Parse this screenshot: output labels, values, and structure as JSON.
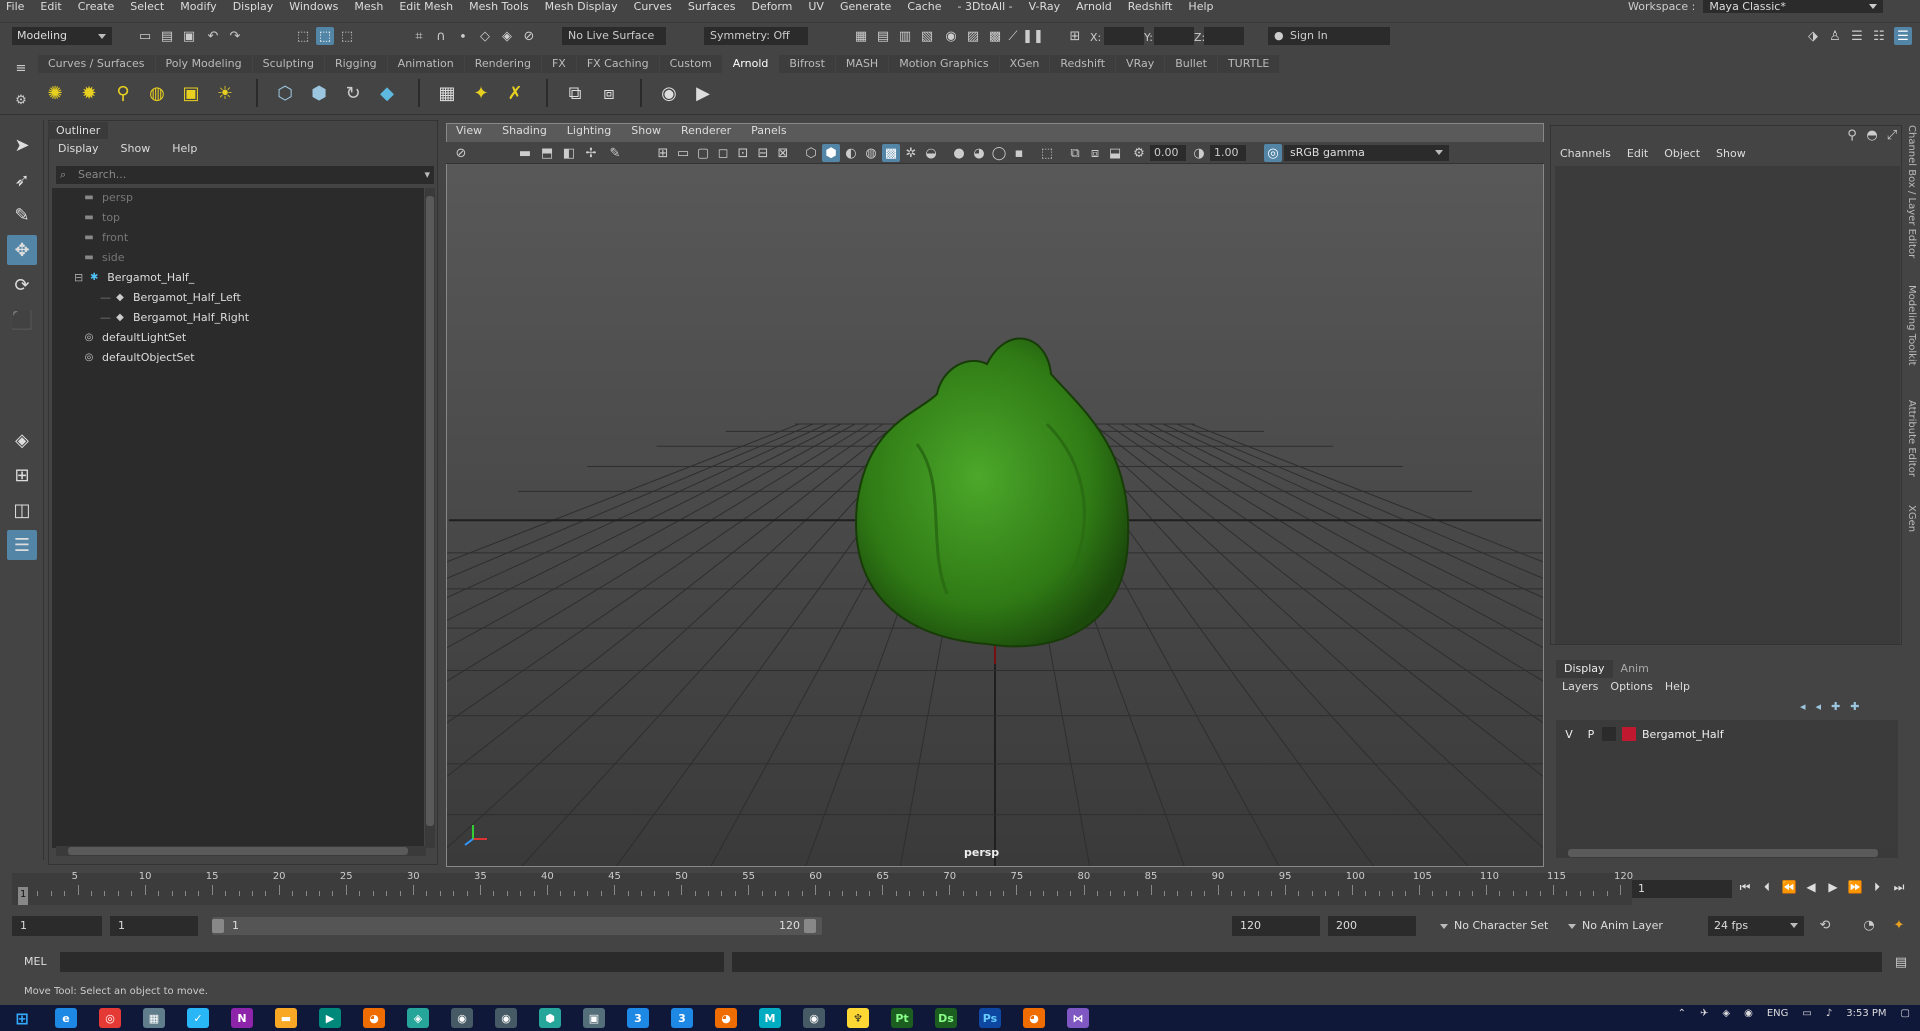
{
  "menubar": {
    "items": [
      "File",
      "Edit",
      "Create",
      "Select",
      "Modify",
      "Display",
      "Windows",
      "Mesh",
      "Edit Mesh",
      "Mesh Tools",
      "Mesh Display",
      "Curves",
      "Surfaces",
      "Deform",
      "UV",
      "Generate",
      "Cache",
      "- 3DtoAll -",
      "V-Ray",
      "Arnold",
      "Redshift",
      "Help"
    ],
    "workspace_label": "Workspace :",
    "workspace_value": "Maya Classic*"
  },
  "statusline": {
    "mode": "Modeling",
    "live_surface": "No Live Surface",
    "symmetry": "Symmetry: Off",
    "x_label": "X:",
    "y_label": "Y:",
    "z_label": "Z:",
    "sign_in": "Sign In"
  },
  "shelf": {
    "tabs": [
      "Curves / Surfaces",
      "Poly Modeling",
      "Sculpting",
      "Rigging",
      "Animation",
      "Rendering",
      "FX",
      "FX Caching",
      "Custom",
      "Arnold",
      "Bifrost",
      "MASH",
      "Motion Graphics",
      "XGen",
      "Redshift",
      "VRay",
      "Bullet",
      "TURTLE"
    ],
    "active_tab": "Arnold"
  },
  "outliner": {
    "title": "Outliner",
    "menu": [
      "Display",
      "Show",
      "Help"
    ],
    "search_placeholder": "Search...",
    "items": [
      {
        "label": "persp",
        "icon": "camera-icon",
        "dim": true,
        "indent": 1
      },
      {
        "label": "top",
        "icon": "camera-icon",
        "dim": true,
        "indent": 1
      },
      {
        "label": "front",
        "icon": "camera-icon",
        "dim": true,
        "indent": 1
      },
      {
        "label": "side",
        "icon": "camera-icon",
        "dim": true,
        "indent": 1
      },
      {
        "label": "Bergamot_Half_",
        "icon": "group-icon",
        "dim": false,
        "indent": 0
      },
      {
        "label": "Bergamot_Half_Left",
        "icon": "mesh-icon",
        "dim": false,
        "indent": 2
      },
      {
        "label": "Bergamot_Half_Right",
        "icon": "mesh-icon",
        "dim": false,
        "indent": 2
      },
      {
        "label": "defaultLightSet",
        "icon": "set-icon",
        "dim": false,
        "indent": 1
      },
      {
        "label": "defaultObjectSet",
        "icon": "set-icon",
        "dim": false,
        "indent": 1
      }
    ]
  },
  "viewport": {
    "menu": [
      "View",
      "Shading",
      "Lighting",
      "Show",
      "Renderer",
      "Panels"
    ],
    "exposure": "0.00",
    "gamma": "1.00",
    "color_space": "sRGB gamma",
    "camera_label": "persp",
    "object_color": "#3a8a1a"
  },
  "channelbox": {
    "menu": [
      "Channels",
      "Edit",
      "Object",
      "Show"
    ]
  },
  "layereditor": {
    "tabs": [
      "Display",
      "Anim"
    ],
    "active_tab": "Display",
    "menu": [
      "Layers",
      "Options",
      "Help"
    ],
    "layers": [
      {
        "v": "V",
        "p": "P",
        "name": "Bergamot_Half",
        "color": "#c0182f"
      }
    ]
  },
  "sidetabs": [
    "Channel Box / Layer Editor",
    "Modeling Toolkit",
    "Attribute Editor",
    "XGen"
  ],
  "timeslider": {
    "labels": [
      "5",
      "10",
      "15",
      "20",
      "25",
      "30",
      "35",
      "40",
      "45",
      "50",
      "55",
      "60",
      "65",
      "70",
      "75",
      "80",
      "85",
      "90",
      "95",
      "100",
      "105",
      "110",
      "115",
      "120"
    ],
    "current_label": "1",
    "current_frame": "1"
  },
  "range": {
    "start": "1",
    "playback_start": "1",
    "slider_start": "1",
    "slider_end": "120",
    "playback_end": "120",
    "end": "200",
    "character_set": "No Character Set",
    "anim_layer": "No Anim Layer",
    "fps": "24 fps"
  },
  "cmdline": {
    "label": "MEL"
  },
  "helpline": {
    "text": "Move Tool: Select an object to move."
  },
  "taskbar": {
    "time": "3:53 PM",
    "lang": "ENG"
  }
}
